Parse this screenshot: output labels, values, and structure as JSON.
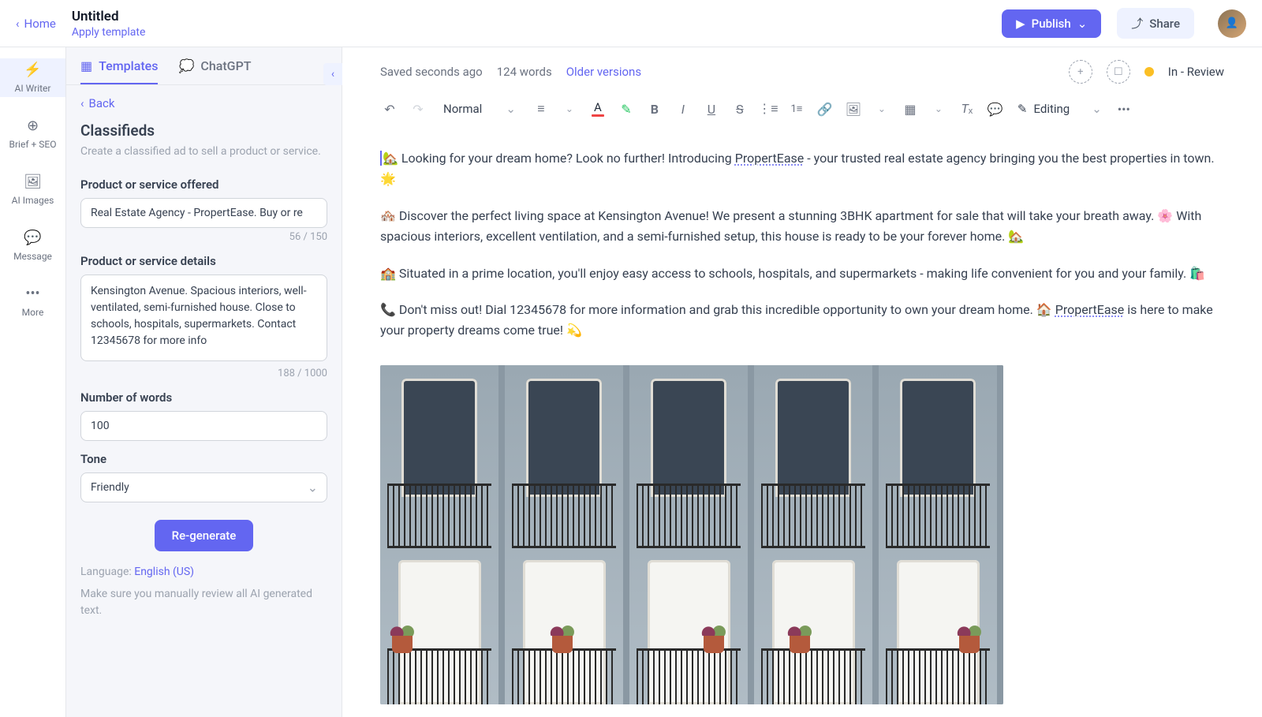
{
  "header": {
    "home_label": "Home",
    "doc_title": "Untitled",
    "apply_template": "Apply template",
    "publish_label": "Publish",
    "share_label": "Share"
  },
  "rail": {
    "items": [
      {
        "label": "AI Writer"
      },
      {
        "label": "Brief + SEO"
      },
      {
        "label": "AI Images"
      },
      {
        "label": "Message"
      },
      {
        "label": "More"
      }
    ]
  },
  "panel": {
    "tabs": {
      "templates": "Templates",
      "chatgpt": "ChatGPT"
    },
    "back_label": "Back",
    "title": "Classifieds",
    "subtitle": "Create a classified ad to sell a product or service.",
    "fields": {
      "product_offered": {
        "label": "Product or service offered",
        "value": "Real Estate Agency - PropertEase. Buy or re",
        "count": "56 / 150"
      },
      "product_details": {
        "label": "Product or service details",
        "value": "Kensington Avenue. Spacious interiors, well-ventilated, semi-furnished house. Close to schools, hospitals, supermarkets. Contact 12345678 for more info",
        "count": "188 / 1000"
      },
      "num_words": {
        "label": "Number of words",
        "value": "100"
      },
      "tone": {
        "label": "Tone",
        "value": "Friendly"
      }
    },
    "regenerate": "Re-generate",
    "language_prefix": "Language: ",
    "language_value": "English (US)",
    "review_note": "Make sure you manually review all AI generated text."
  },
  "status": {
    "saved": "Saved seconds ago",
    "word_count": "124 words",
    "older_versions": "Older versions",
    "review_state": "In - Review"
  },
  "toolbar": {
    "style": "Normal",
    "editing": "Editing"
  },
  "content": {
    "p1a": "🏡 Looking for your dream home? Look no further! Introducing ",
    "p1b": "PropertEase",
    "p1c": " - your trusted real estate agency bringing you the best properties in town. 🌟",
    "p2": "🏘️ Discover the perfect living space at Kensington Avenue! We present a stunning 3BHK apartment for sale that will take your breath away. 🌸 With spacious interiors, excellent ventilation, and a semi-furnished setup, this house is ready to be your forever home. 🏡",
    "p3": "🏫 Situated in a prime location, you'll enjoy easy access to schools, hospitals, and supermarkets - making life convenient for you and your family. 🛍️",
    "p4a": "📞 Don't miss out! Dial 12345678 for more information and grab this incredible opportunity to own your dream home. 🏠 ",
    "p4b": "PropertEase",
    "p4c": " is here to make your property dreams come true! 💫"
  }
}
